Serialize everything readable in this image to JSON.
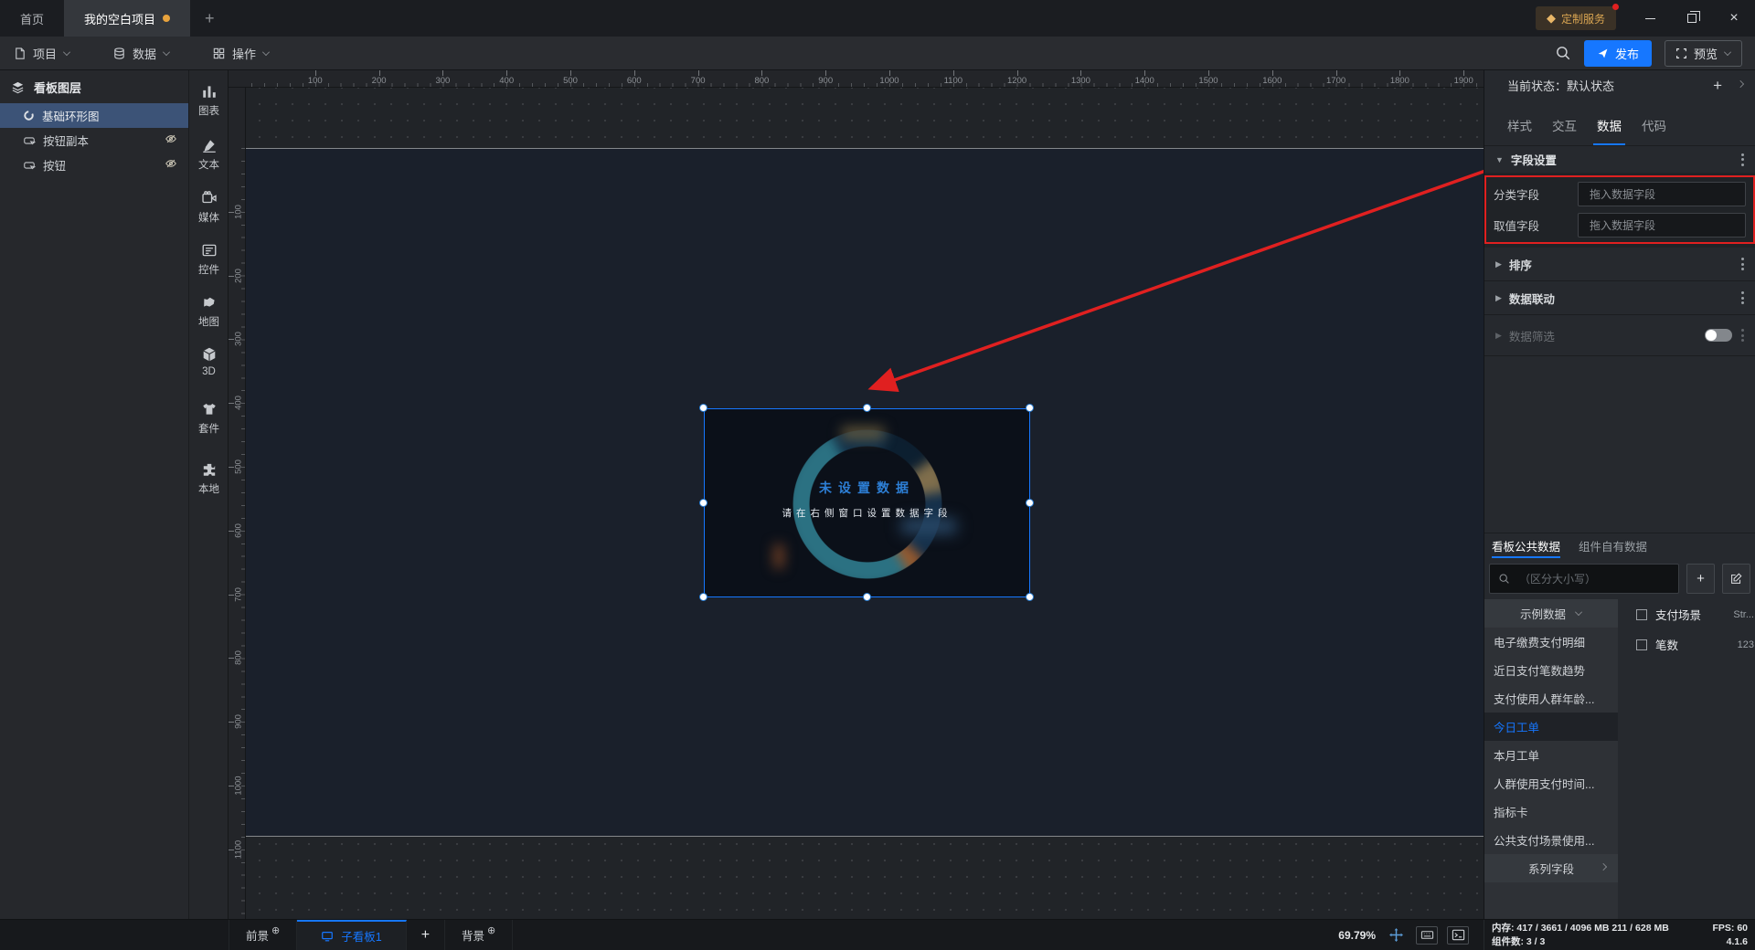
{
  "colors": {
    "accent": "#1677ff",
    "arrow": "#e02020",
    "modified_dot": "#e8a33d",
    "badge_gold": "#d9a552",
    "selection": "#1677ff"
  },
  "window": {
    "tabs": [
      {
        "label": "首页"
      },
      {
        "label": "我的空白项目"
      }
    ],
    "new_tab": "+",
    "badge": "定制服务"
  },
  "menubar": {
    "items": [
      {
        "label": "项目"
      },
      {
        "label": "数据"
      },
      {
        "label": "操作"
      }
    ],
    "publish": "发布",
    "preview": "预览"
  },
  "layers": {
    "title": "看板图层",
    "items": [
      {
        "label": "基础环形图",
        "selected": true,
        "hidden": false
      },
      {
        "label": "按钮副本",
        "selected": false,
        "hidden": true
      },
      {
        "label": "按钮",
        "selected": false,
        "hidden": true
      }
    ]
  },
  "toolbox": {
    "items": [
      "图表",
      "文本",
      "媒体",
      "控件",
      "地图",
      "3D",
      "套件",
      "本地"
    ]
  },
  "canvas": {
    "h_ticks": [
      100,
      200,
      300,
      400,
      500,
      600,
      700,
      800,
      900,
      1000,
      1100,
      1200,
      1300,
      1400,
      1500,
      1600,
      1700,
      1800,
      1900
    ],
    "v_ticks": [
      100,
      200,
      300,
      400,
      500,
      600,
      700,
      800,
      900,
      1000,
      1100
    ],
    "widget": {
      "title": "未设置数据",
      "hint": "请在右侧窗口设置数据字段"
    }
  },
  "inspector": {
    "state_label": "当前状态：默认状态",
    "add": "+",
    "tabs": [
      "样式",
      "交互",
      "数据",
      "代码"
    ],
    "active_tab": "数据",
    "field_section": "字段设置",
    "field_rows": [
      {
        "label": "分类字段",
        "placeholder": "拖入数据字段"
      },
      {
        "label": "取值字段",
        "placeholder": "拖入数据字段"
      }
    ],
    "sections": [
      "排序",
      "数据联动"
    ],
    "disabled_section": "数据筛选"
  },
  "datapanel": {
    "tabs": [
      "看板公共数据",
      "组件自有数据"
    ],
    "active_tab": "看板公共数据",
    "search_placeholder": "（区分大小写）",
    "add": "+",
    "source_select": "示例数据",
    "items": [
      "电子缴费支付明细",
      "近日支付笔数趋势",
      "支付使用人群年龄...",
      "今日工单",
      "本月工单",
      "人群使用支付时间...",
      "指标卡",
      "公共支付场景使用..."
    ],
    "selected_item": "今日工单",
    "series_row": "系列字段",
    "fields": [
      {
        "name": "支付场景",
        "type": "Str..."
      },
      {
        "name": "笔数",
        "type": "123"
      }
    ]
  },
  "bottombar": {
    "foreground": "前景",
    "board_tab": "子看板1",
    "add": "+",
    "background": "背景",
    "zoom": "69.79%"
  },
  "statusbar": {
    "memory_label": "内存:",
    "memory": "417 / 3661 / 4096 MB  211 / 628 MB",
    "fps_label": "FPS:",
    "fps": "60",
    "components_label": "组件数:",
    "components": "3 / 3",
    "version": "4.1.6"
  }
}
